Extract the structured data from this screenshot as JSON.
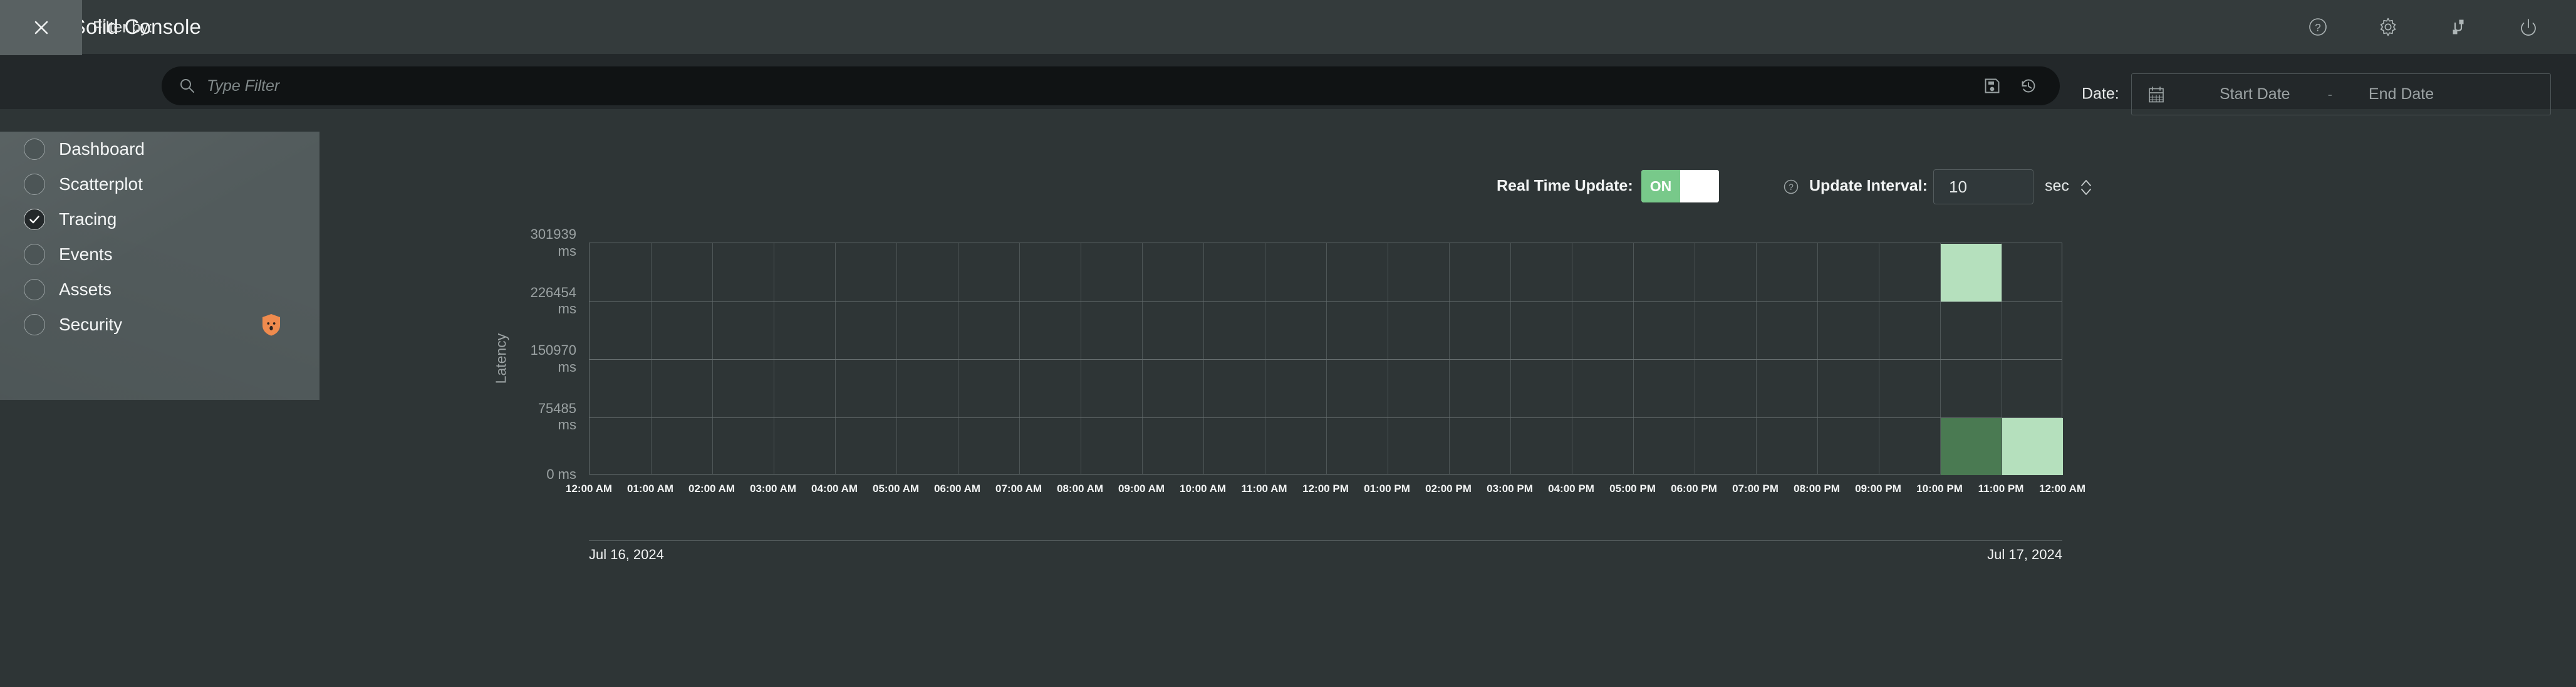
{
  "app": {
    "title": "N|Solid Console",
    "logo_icon": "nsolid-hexagon-logo",
    "accent_green": "#78c98a"
  },
  "topbar": {
    "actions": [
      {
        "name": "help-icon",
        "label": "Help"
      },
      {
        "name": "gear-icon",
        "label": "Settings"
      },
      {
        "name": "connection-icon",
        "label": "Connection"
      },
      {
        "name": "power-icon",
        "label": "Log Out"
      }
    ]
  },
  "filterbar": {
    "close_icon": "close-icon",
    "filter_label": "Filter by:",
    "search_icon": "search-icon",
    "filter_placeholder": "Type Filter",
    "filter_value": "",
    "save_icon": "save-filter-icon",
    "history_icon": "filter-history-icon",
    "date_label": "Date:",
    "calendar_icon": "calendar-icon",
    "start_date_placeholder": "Start Date",
    "date_separator": "-",
    "end_date_placeholder": "End Date"
  },
  "nav": {
    "items": [
      {
        "label": "Dashboard",
        "selected": false,
        "badge": null
      },
      {
        "label": "Scatterplot",
        "selected": false,
        "badge": null
      },
      {
        "label": "Tracing",
        "selected": true,
        "badge": null
      },
      {
        "label": "Events",
        "selected": false,
        "badge": null
      },
      {
        "label": "Assets",
        "selected": false,
        "badge": null
      },
      {
        "label": "Security",
        "selected": false,
        "badge": "security-shield-icon"
      }
    ]
  },
  "controls": {
    "real_time_label": "Real Time Update:",
    "toggle_state": "ON",
    "info_icon": "help-circle-icon",
    "update_interval_label": "Update Interval:",
    "update_interval_value": "10",
    "update_interval_unit": "sec",
    "stepper_icon": "spinner-updown-icon"
  },
  "chart_data": {
    "type": "heatmap",
    "title": "",
    "xlabel": "",
    "ylabel": "Latency",
    "ytick_labels": [
      "301939 ms",
      "226454 ms",
      "150970 ms",
      "75485 ms",
      "0 ms"
    ],
    "ylim": [
      0,
      301939
    ],
    "yunit": "ms",
    "rows": 4,
    "cols": 24,
    "grid": true,
    "x": [
      "12:00 AM",
      "01:00 AM",
      "02:00 AM",
      "03:00 AM",
      "04:00 AM",
      "05:00 AM",
      "06:00 AM",
      "07:00 AM",
      "08:00 AM",
      "09:00 AM",
      "10:00 AM",
      "11:00 AM",
      "12:00 PM",
      "01:00 PM",
      "02:00 PM",
      "03:00 PM",
      "04:00 PM",
      "05:00 PM",
      "06:00 PM",
      "07:00 PM",
      "08:00 PM",
      "09:00 PM",
      "10:00 PM",
      "11:00 PM",
      "12:00 AM"
    ],
    "colors": {
      "empty": "#313839",
      "low": "#b5e0bd",
      "high": "#4a7a52"
    },
    "cells": [
      {
        "col": 23,
        "row": 0,
        "bucket": "226454-301939 ms",
        "time": "11:00 PM",
        "intensity": "low",
        "color": "#b5e0bd"
      },
      {
        "col": 23,
        "row": 3,
        "bucket": "0-75485 ms",
        "time": "11:00 PM",
        "intensity": "high",
        "color": "#4a7a52"
      },
      {
        "col": 24,
        "row": 3,
        "bucket": "0-75485 ms",
        "time": "12:00 AM",
        "intensity": "low",
        "color": "#b5e0bd"
      }
    ],
    "footer_start_date": "Jul 16, 2024",
    "footer_end_date": "Jul 17, 2024"
  }
}
